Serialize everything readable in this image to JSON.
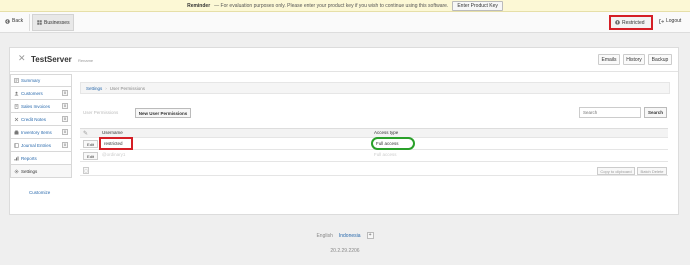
{
  "reminder": {
    "label": "Reminder",
    "message": "— For evaluation purposes only. Please enter your product key if you wish to continue using this software.",
    "button": "Enter Product Key"
  },
  "topbar": {
    "back": "Back",
    "businesses": "Businesses",
    "user": "Restricted",
    "logout": "Logout"
  },
  "business": {
    "name": "TestServer",
    "rename": "Rename",
    "buttons": {
      "emails": "Emails",
      "history": "History",
      "backup": "Backup"
    }
  },
  "sidebar": {
    "items": [
      {
        "label": "Summary",
        "icon": "summary-icon",
        "badge": ""
      },
      {
        "label": "Customers",
        "icon": "customers-icon",
        "badge": "0"
      },
      {
        "label": "Sales Invoices",
        "icon": "invoice-icon",
        "badge": "0"
      },
      {
        "label": "Credit Notes",
        "icon": "credit-icon",
        "badge": "0"
      },
      {
        "label": "Inventory Items",
        "icon": "inventory-icon",
        "badge": "0"
      },
      {
        "label": "Journal Entries",
        "icon": "journal-icon",
        "badge": "0"
      },
      {
        "label": "Reports",
        "icon": "reports-icon",
        "badge": ""
      },
      {
        "label": "Settings",
        "icon": "settings-icon",
        "badge": ""
      }
    ],
    "customize": "Customize"
  },
  "breadcrumb": {
    "root": "Settings",
    "sep": "›",
    "current": "User Permissions"
  },
  "permissions": {
    "tab_label": "User Permissions",
    "new_button": "New User Permissions",
    "search_placeholder": "Search",
    "search_button": "Search",
    "columns": {
      "username": "Username",
      "access": "Access type"
    },
    "rows": [
      {
        "edit": "Edit",
        "username": "restricted",
        "access": "Full access"
      },
      {
        "edit": "Edit",
        "username": "@ordinary1",
        "access": "Full access"
      }
    ],
    "footer": {
      "clipboard": "Copy to clipboard",
      "batch_delete": "Batch Delete"
    }
  },
  "footer": {
    "lang_en": "English",
    "lang_id": "Indonesia",
    "plus": "+",
    "version": "20.2.29.2206"
  },
  "colors": {
    "accent_red": "#d51f26",
    "accent_green": "#2aa02a",
    "link": "#2a6aad"
  }
}
